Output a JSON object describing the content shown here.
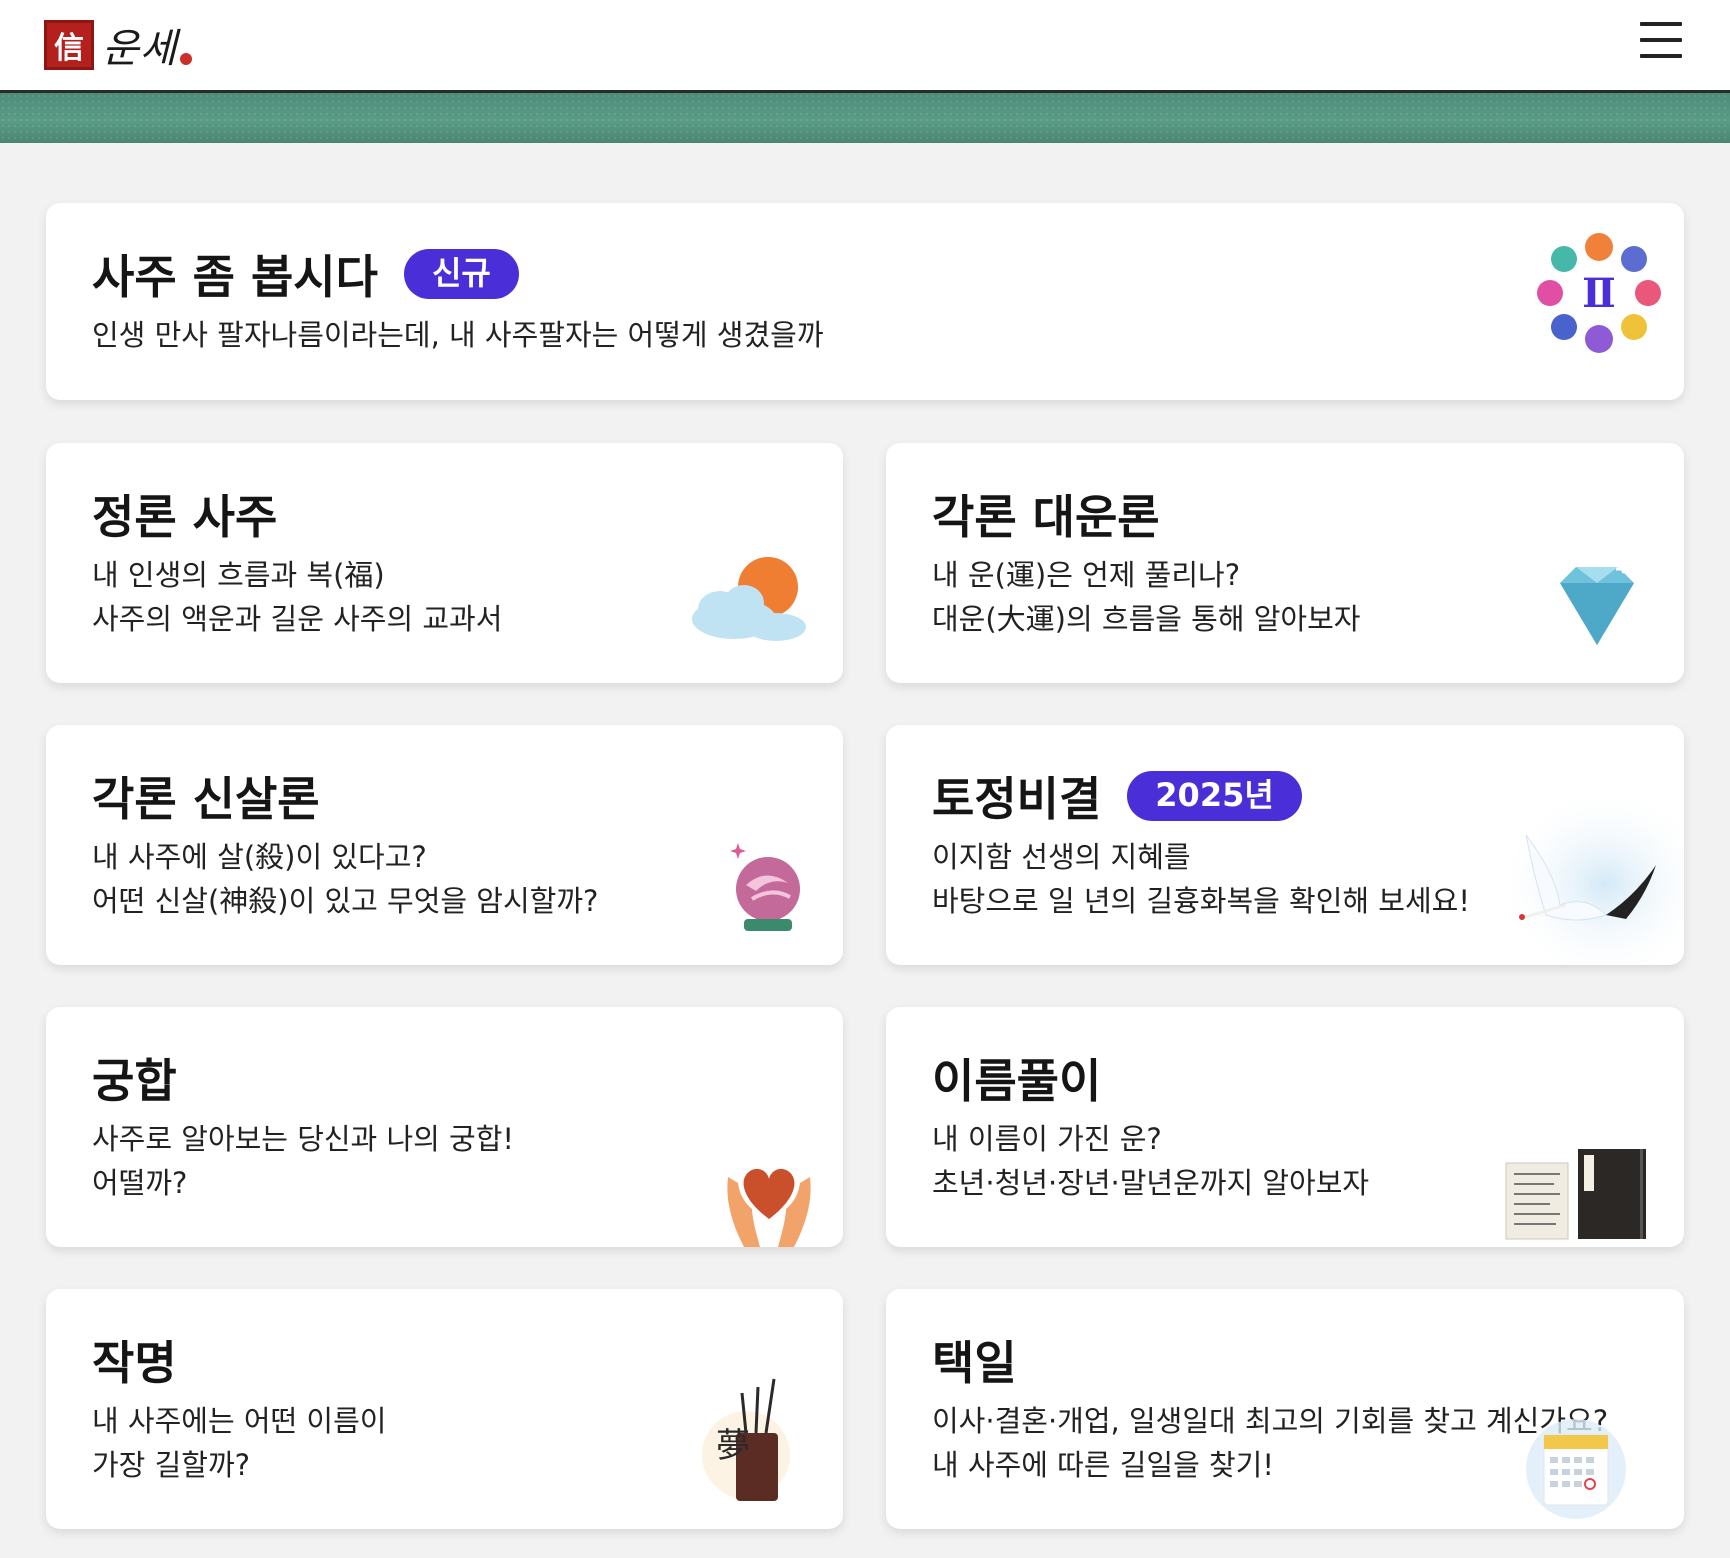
{
  "header": {
    "logo_seal": "信",
    "logo_text": "운세",
    "menu_label": "menu"
  },
  "cards": [
    {
      "title": "사주 좀 봅시다",
      "badge": "신규",
      "desc": [
        "인생 만사 팔자나름이라는데, 내 사주팔자는 어떻게 생겼을까"
      ],
      "icon": "zodiac-icon"
    },
    {
      "title": "정론 사주",
      "desc": [
        "내 인생의 흐름과 복(福)",
        "사주의 액운과 길운 사주의 교과서"
      ],
      "icon": "sun-cloud-icon"
    },
    {
      "title": "각론 대운론",
      "desc": [
        "내 운(運)은 언제 풀리나?",
        "대운(大運)의 흐름을 통해 알아보자"
      ],
      "icon": "diamond-icon"
    },
    {
      "title": "각론 신살론",
      "desc": [
        "내 사주에 살(殺)이 있다고?",
        "어떤 신살(神殺)이 있고 무엇을 암시할까?"
      ],
      "icon": "crystal-ball-icon"
    },
    {
      "title": "토정비결",
      "badge": "2025년",
      "desc": [
        "이지함 선생의 지혜를",
        "바탕으로 일 년의 길흉화복을 확인해 보세요!"
      ],
      "icon": "crane-icon"
    },
    {
      "title": "궁합",
      "desc": [
        "사주로 알아보는 당신과 나의 궁합!",
        "어떨까?"
      ],
      "icon": "heart-hands-icon"
    },
    {
      "title": "이름풀이",
      "desc": [
        "내 이름이 가진 운?",
        "초년·청년·장년·말년운까지 알아보자"
      ],
      "icon": "book-icon"
    },
    {
      "title": "작명",
      "desc": [
        "내 사주에는 어떤 이름이",
        "가장 길할까?"
      ],
      "icon": "brush-holder-icon"
    },
    {
      "title": "택일",
      "desc": [
        "이사·결혼·개업, 일생일대 최고의 기회를 찾고 계신가요?",
        "내 사주에 따른 길일을 찾기!"
      ],
      "icon": "calendar-icon"
    }
  ]
}
